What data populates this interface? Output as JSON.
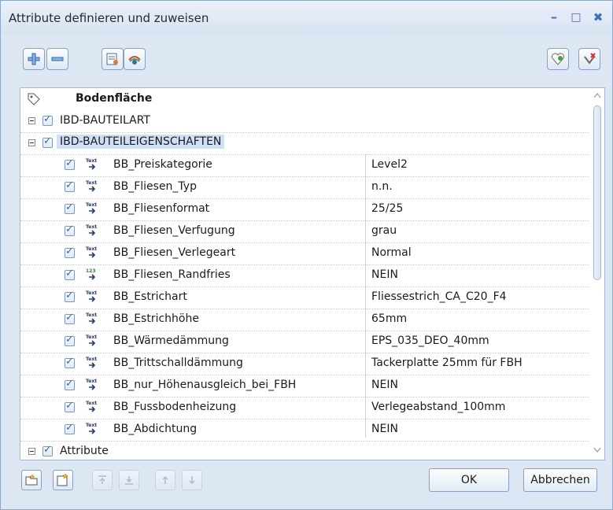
{
  "window": {
    "title": "Attribute definieren und zuweisen",
    "minimize": "–",
    "maximize": "□",
    "close": "✖"
  },
  "tree": {
    "root_label": "Bodenfläche",
    "groups": [
      {
        "label": "IBD-BAUTEILART"
      },
      {
        "label": "IBD-BAUTEILEIGENSCHAFTEN"
      },
      {
        "label": "Attribute"
      }
    ],
    "type_icons": {
      "text": "Text",
      "number": "123"
    },
    "rows": [
      {
        "name": "BB_Preiskategorie",
        "value": "Level2",
        "type": "text"
      },
      {
        "name": "BB_Fliesen_Typ",
        "value": "n.n.",
        "type": "text"
      },
      {
        "name": "BB_Fliesenformat",
        "value": "25/25",
        "type": "text"
      },
      {
        "name": "BB_Fliesen_Verfugung",
        "value": "grau",
        "type": "text"
      },
      {
        "name": "BB_Fliesen_Verlegeart",
        "value": "Normal",
        "type": "text"
      },
      {
        "name": "BB_Fliesen_Randfries",
        "value": "NEIN",
        "type": "number"
      },
      {
        "name": "BB_Estrichart",
        "value": "Fliessestrich_CA_C20_F4",
        "type": "text"
      },
      {
        "name": "BB_Estrichhöhe",
        "value": "65mm",
        "type": "text"
      },
      {
        "name": "BB_Wärmedämmung",
        "value": "EPS_035_DEO_40mm",
        "type": "text"
      },
      {
        "name": "BB_Trittschalldämmung",
        "value": "Tackerplatte 25mm für FBH",
        "type": "text"
      },
      {
        "name": "BB_nur_Höhenausgleich_bei_FBH",
        "value": "NEIN",
        "type": "text"
      },
      {
        "name": "BB_Fussbodenheizung",
        "value": "Verlegeabstand_100mm",
        "type": "text"
      },
      {
        "name": "BB_Abdichtung",
        "value": "NEIN",
        "type": "text"
      }
    ]
  },
  "buttons": {
    "ok": "OK",
    "cancel": "Abbrechen"
  },
  "colors": {
    "selection": "#cfe0f6",
    "accent": "#2d6bc0"
  }
}
